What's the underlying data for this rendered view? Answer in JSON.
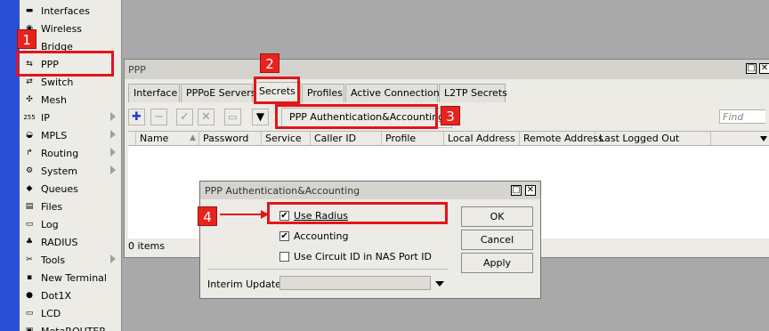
{
  "sidebar": {
    "items": [
      {
        "label": "Interfaces",
        "icon": "interfaces-icon",
        "icon_char": "▬",
        "arrow": false
      },
      {
        "label": "Wireless",
        "icon": "wireless-icon",
        "icon_char": "◉",
        "arrow": false
      },
      {
        "label": "Bridge",
        "icon": "bridge-icon",
        "icon_char": "⧉",
        "arrow": false
      },
      {
        "label": "PPP",
        "icon": "ppp-icon",
        "icon_char": "⇆",
        "arrow": false
      },
      {
        "label": "Switch",
        "icon": "switch-icon",
        "icon_char": "⇄",
        "arrow": false
      },
      {
        "label": "Mesh",
        "icon": "mesh-icon",
        "icon_char": "✣",
        "arrow": false
      },
      {
        "label": "IP",
        "icon": "ip-icon",
        "icon_char": "255",
        "arrow": true
      },
      {
        "label": "MPLS",
        "icon": "mpls-icon",
        "icon_char": "◒",
        "arrow": true
      },
      {
        "label": "Routing",
        "icon": "routing-icon",
        "icon_char": "↱",
        "arrow": true
      },
      {
        "label": "System",
        "icon": "system-icon",
        "icon_char": "⚙",
        "arrow": true
      },
      {
        "label": "Queues",
        "icon": "queues-icon",
        "icon_char": "◆",
        "arrow": false
      },
      {
        "label": "Files",
        "icon": "files-icon",
        "icon_char": "▤",
        "arrow": false
      },
      {
        "label": "Log",
        "icon": "log-icon",
        "icon_char": "▭",
        "arrow": false
      },
      {
        "label": "RADIUS",
        "icon": "radius-icon",
        "icon_char": "♣",
        "arrow": false
      },
      {
        "label": "Tools",
        "icon": "tools-icon",
        "icon_char": "✂",
        "arrow": true
      },
      {
        "label": "New Terminal",
        "icon": "terminal-icon",
        "icon_char": "▪",
        "arrow": false
      },
      {
        "label": "Dot1X",
        "icon": "dot1x-icon",
        "icon_char": "●",
        "arrow": false
      },
      {
        "label": "LCD",
        "icon": "lcd-icon",
        "icon_char": "▭",
        "arrow": false
      },
      {
        "label": "MetaROUTER",
        "icon": "metarouter-icon",
        "icon_char": "▣",
        "arrow": false
      }
    ]
  },
  "ppp_window": {
    "title": "PPP",
    "tabs": [
      "Interface",
      "PPPoE Servers",
      "Secrets",
      "Profiles",
      "Active Connections",
      "L2TP Secrets"
    ],
    "auth_button": "PPP Authentication&Accounting",
    "find_placeholder": "Find",
    "columns": [
      "Name",
      "Password",
      "Service",
      "Caller ID",
      "Profile",
      "Local Address",
      "Remote Address",
      "Last Logged Out"
    ],
    "item_count": "0 items"
  },
  "dialog": {
    "title": "PPP Authentication&Accounting",
    "use_radius": "Use Radius",
    "accounting": "Accounting",
    "circuit_id": "Use Circuit ID in NAS Port ID",
    "use_radius_checked": true,
    "accounting_checked": true,
    "circuit_id_checked": false,
    "ok": "OK",
    "cancel": "Cancel",
    "apply": "Apply",
    "interim_label": "Interim Update:"
  },
  "annotations": [
    "1",
    "2",
    "3",
    "4"
  ],
  "colors": {
    "annotation_red": "#e3141a",
    "accent_blue": "#2a4fd6"
  }
}
